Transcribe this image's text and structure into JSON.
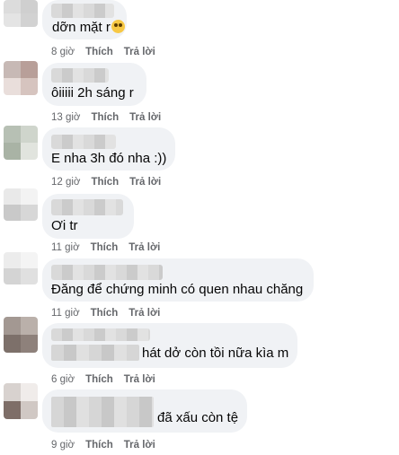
{
  "comments": [
    {
      "text": "dỡn mặt r",
      "emoji": "pleading-face-icon",
      "time": "8 giờ",
      "like": "Thích",
      "reply": "Trả lời"
    },
    {
      "text": "ôiiiii 2h sáng r",
      "time": "13 giờ",
      "like": "Thích",
      "reply": "Trả lời"
    },
    {
      "text": "E nha 3h đó nha :))",
      "time": "12 giờ",
      "like": "Thích",
      "reply": "Trả lời"
    },
    {
      "text": "Ơi tr",
      "time": "11 giờ",
      "like": "Thích",
      "reply": "Trả lời"
    },
    {
      "text": "Đăng để chứng minh có quen nhau chăng",
      "time": "11 giờ",
      "like": "Thích",
      "reply": "Trả lời"
    },
    {
      "text": "hát dở còn tồi nữa kìa m",
      "time": "6 giờ",
      "like": "Thích",
      "reply": "Trả lời"
    },
    {
      "text": "đã xấu còn tệ",
      "time": "9 giờ",
      "like": "Thích",
      "reply": "Trả lời"
    }
  ]
}
